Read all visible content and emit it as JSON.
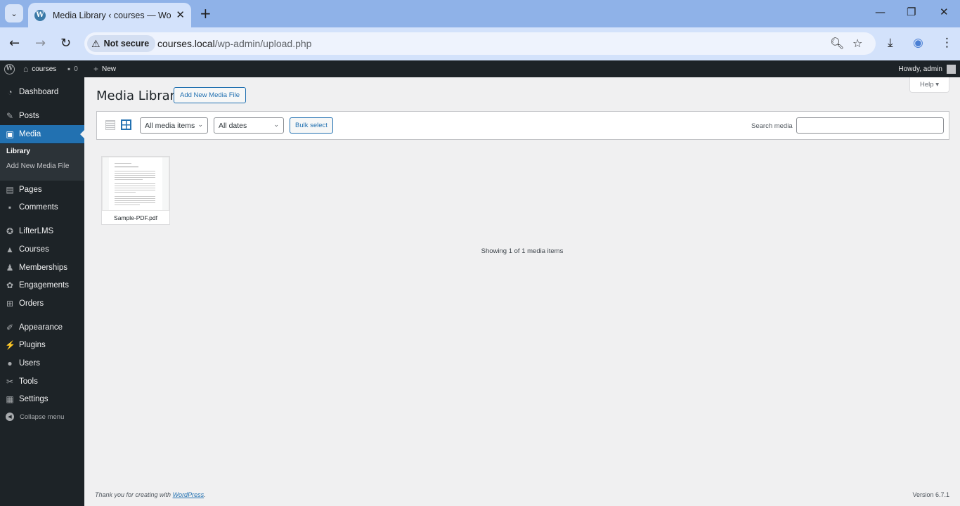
{
  "browser": {
    "tab_title": "Media Library ‹ courses — WordPress",
    "favicon_glyph": "W",
    "security_label": "Not secure",
    "url_host": "courses.local",
    "url_path": "/wp-admin/upload.php",
    "icons": {
      "tab_list": "⌄",
      "close": "✕",
      "new_tab": "+",
      "minimize": "—",
      "restore": "❐",
      "window_close": "✕",
      "back": "←",
      "forward": "→",
      "reload": "↻",
      "warning": "⚠",
      "zoom": "🔍︎",
      "bookmark": "☆",
      "download": "⤓",
      "extension": "◉",
      "menu": "⋮"
    }
  },
  "adminbar": {
    "logo_glyph": "W",
    "site_name": "courses",
    "comments_count": "0",
    "new_label": "New",
    "greeting": "Howdy, admin",
    "icons": {
      "home": "⌂",
      "comment": "▪",
      "plus": "+"
    }
  },
  "sidebar": {
    "items": [
      {
        "label": "Dashboard",
        "icon": "◔"
      },
      {
        "label": "Posts",
        "icon": "✎"
      },
      {
        "label": "Media",
        "icon": "▣",
        "active": true
      },
      {
        "label": "Pages",
        "icon": "▤"
      },
      {
        "label": "Comments",
        "icon": "▪"
      },
      {
        "label": "LifterLMS",
        "icon": "✪"
      },
      {
        "label": "Courses",
        "icon": "▲"
      },
      {
        "label": "Memberships",
        "icon": "♟"
      },
      {
        "label": "Engagements",
        "icon": "✿"
      },
      {
        "label": "Orders",
        "icon": "⊞"
      },
      {
        "label": "Appearance",
        "icon": "✐"
      },
      {
        "label": "Plugins",
        "icon": "⚡"
      },
      {
        "label": "Users",
        "icon": "●"
      },
      {
        "label": "Tools",
        "icon": "✂"
      },
      {
        "label": "Settings",
        "icon": "▦"
      }
    ],
    "submenu": [
      {
        "label": "Library",
        "current": true
      },
      {
        "label": "Add New Media File"
      }
    ],
    "collapse_label": "Collapse menu",
    "collapse_icon": "◀"
  },
  "main": {
    "title": "Media Library",
    "add_new_label": "Add New Media File",
    "help_label": "Help ▾",
    "filter": {
      "type_selected": "All media items",
      "date_selected": "All dates",
      "bulk_label": "Bulk select",
      "search_label": "Search media",
      "search_value": "",
      "chevron": "⌄"
    },
    "attachments": [
      {
        "filename": "Sample-PDF.pdf"
      }
    ],
    "count_text": "Showing 1 of 1 media items"
  },
  "footer": {
    "thanks_prefix": "Thank you for creating with ",
    "thanks_link": "WordPress",
    "thanks_suffix": ".",
    "version": "Version 6.7.1"
  }
}
